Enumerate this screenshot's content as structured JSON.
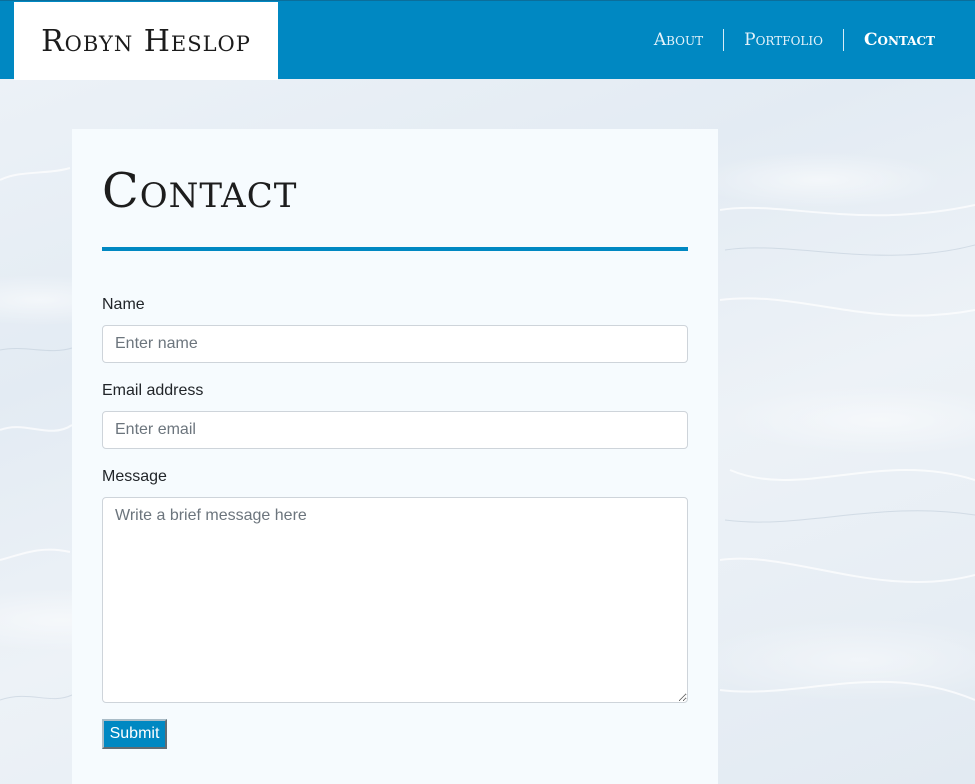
{
  "header": {
    "brand": "Robyn Heslop",
    "nav": [
      {
        "label": "About",
        "active": false
      },
      {
        "label": "Portfolio",
        "active": false
      },
      {
        "label": "Contact",
        "active": true
      }
    ]
  },
  "main": {
    "title": "Contact",
    "form": {
      "name_label": "Name",
      "name_placeholder": "Enter name",
      "email_label": "Email address",
      "email_placeholder": "Enter email",
      "message_label": "Message",
      "message_placeholder": "Write a brief message here",
      "submit_label": "Submit"
    }
  },
  "colors": {
    "accent": "#0088c2",
    "card_background": "#f6fbfe",
    "page_background": "#e9f0f6"
  }
}
